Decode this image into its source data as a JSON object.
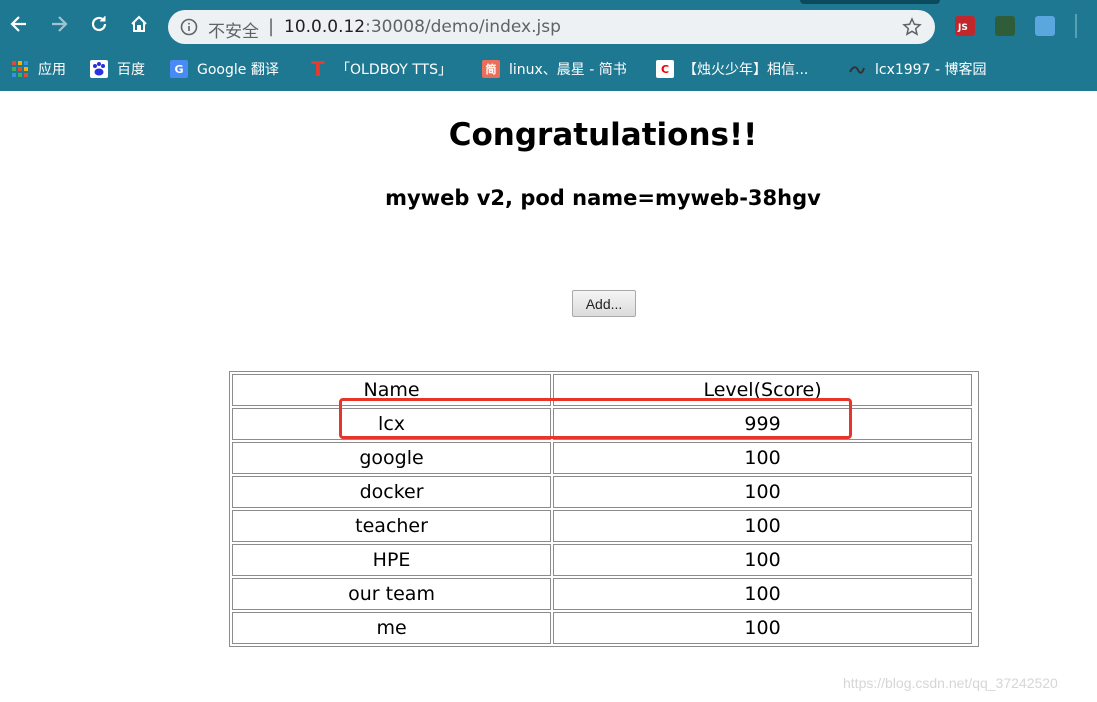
{
  "browser": {
    "security_label": "不安全",
    "separator": "|",
    "url_host": "10.0.0.12",
    "url_rest": ":30008/demo/index.jsp",
    "bookmarks": [
      {
        "label": "应用",
        "icon": "apps-grid-icon"
      },
      {
        "label": "百度",
        "icon": "baidu-paw-icon"
      },
      {
        "label": "Google 翻译",
        "icon": "google-translate-icon"
      },
      {
        "label": "「OLDBOY TTS」",
        "icon": "oldboy-t-icon"
      },
      {
        "label": "linux、晨星 - 简书",
        "icon": "jianshu-icon",
        "icon_text": "简"
      },
      {
        "label": "【烛火少年】相信...",
        "icon": "csdn-c-icon",
        "icon_text": "C"
      },
      {
        "label": "lcx1997 - 博客园",
        "icon": "cnblogs-icon"
      }
    ],
    "colors": {
      "chrome_bg": "#1f7891",
      "omnibox_bg": "#eef1f3"
    }
  },
  "page": {
    "title": "Congratulations!!",
    "subtitle": "myweb v2, pod name=myweb-38hgv",
    "add_button": "Add...",
    "table": {
      "headers": [
        "Name",
        "Level(Score)"
      ],
      "rows": [
        {
          "name": "lcx",
          "score": "999"
        },
        {
          "name": "google",
          "score": "100"
        },
        {
          "name": "docker",
          "score": "100"
        },
        {
          "name": "teacher",
          "score": "100"
        },
        {
          "name": "HPE",
          "score": "100"
        },
        {
          "name": "our team",
          "score": "100"
        },
        {
          "name": "me",
          "score": "100"
        }
      ]
    },
    "highlight_color": "#e8352b"
  },
  "watermark": "https://blog.csdn.net/qq_37242520"
}
